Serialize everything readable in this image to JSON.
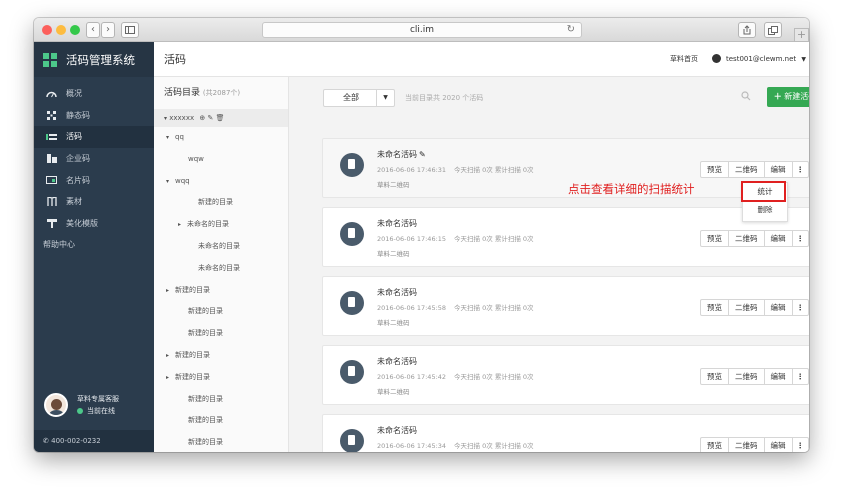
{
  "browser": {
    "url": "cli.im",
    "traffic_light_colors": [
      "#fc605c",
      "#fdbc40",
      "#34c84a"
    ],
    "nav_icons": [
      "back-icon",
      "forward-icon",
      "sidebar-icon"
    ],
    "right_icons": [
      "share-icon",
      "tabs-icon"
    ],
    "new_tab_glyph": "+"
  },
  "sidebar": {
    "brand": "活码管理系统",
    "items": [
      {
        "label": "概况",
        "icon": "gauge-icon",
        "active": false
      },
      {
        "label": "静态码",
        "icon": "qr-icon",
        "active": false
      },
      {
        "label": "活码",
        "icon": "dynamic-code-icon",
        "active": true
      },
      {
        "label": "企业码",
        "icon": "building-icon",
        "active": false
      },
      {
        "label": "名片码",
        "icon": "card-icon",
        "active": false
      },
      {
        "label": "素材",
        "icon": "material-icon",
        "active": false
      },
      {
        "label": "美化模版",
        "icon": "paint-icon",
        "active": false
      }
    ],
    "help": "帮助中心",
    "support_name": "草料专属客服",
    "support_status": "当前在线",
    "phone": "400-002-0232"
  },
  "header": {
    "title": "活码",
    "home_link": "草料首页",
    "user": "test001@clewm.net"
  },
  "directory": {
    "title": "活码目录",
    "count": "(共2087个)",
    "root": "xxxxxx",
    "items": [
      {
        "label": "qq",
        "indent": 1,
        "arrow": "▾"
      },
      {
        "label": "wqw",
        "indent": 2,
        "arrow": ""
      },
      {
        "label": "wqq",
        "indent": 1,
        "arrow": "▾"
      },
      {
        "label": "新建的目录",
        "indent": 3,
        "arrow": ""
      },
      {
        "label": "未命名的目录",
        "indent": 2,
        "arrow": "▸"
      },
      {
        "label": "未命名的目录",
        "indent": 3,
        "arrow": ""
      },
      {
        "label": "未命名的目录",
        "indent": 3,
        "arrow": ""
      },
      {
        "label": "新建的目录",
        "indent": 1,
        "arrow": "▸"
      },
      {
        "label": "新建的目录",
        "indent": 2,
        "arrow": ""
      },
      {
        "label": "新建的目录",
        "indent": 2,
        "arrow": ""
      },
      {
        "label": "新建的目录",
        "indent": 1,
        "arrow": "▸"
      },
      {
        "label": "新建的目录",
        "indent": 1,
        "arrow": "▸"
      },
      {
        "label": "新建的目录",
        "indent": 2,
        "arrow": ""
      },
      {
        "label": "新建的目录",
        "indent": 2,
        "arrow": ""
      },
      {
        "label": "新建的目录",
        "indent": 2,
        "arrow": ""
      }
    ]
  },
  "toolbar": {
    "filter": "全部",
    "total_text": "当前目录共 2020 个活码",
    "new_button": "新建活码"
  },
  "cards": [
    {
      "name": "未命名活码",
      "time": "2016-06-06 17:46:31",
      "stats": "今天扫描 0次  累计扫描 0次",
      "sub": "草料二维码",
      "editable": true
    },
    {
      "name": "未命名活码",
      "time": "2016-06-06 17:46:15",
      "stats": "今天扫描 0次  累计扫描 0次",
      "sub": "草料二维码",
      "editable": false
    },
    {
      "name": "未命名活码",
      "time": "2016-06-06 17:45:58",
      "stats": "今天扫描 0次  累计扫描 0次",
      "sub": "草料二维码",
      "editable": false
    },
    {
      "name": "未命名活码",
      "time": "2016-06-06 17:45:42",
      "stats": "今天扫描 0次  累计扫描 0次",
      "sub": "草料二维码",
      "editable": false
    },
    {
      "name": "未命名活码",
      "time": "2016-06-06 17:45:34",
      "stats": "今天扫描 0次  累计扫描 0次",
      "sub": "草料二维码",
      "editable": false
    }
  ],
  "card_actions": {
    "preview": "预览",
    "qrcode": "二维码",
    "edit": "编辑",
    "more": "⋮"
  },
  "dropdown": {
    "stats": "统计",
    "delete": "删除"
  },
  "annotation": "点击查看详细的扫描统计",
  "colors": {
    "sidebar": "#2b3c4d",
    "accent_green": "#35a853",
    "annotation_red": "#e02020"
  }
}
